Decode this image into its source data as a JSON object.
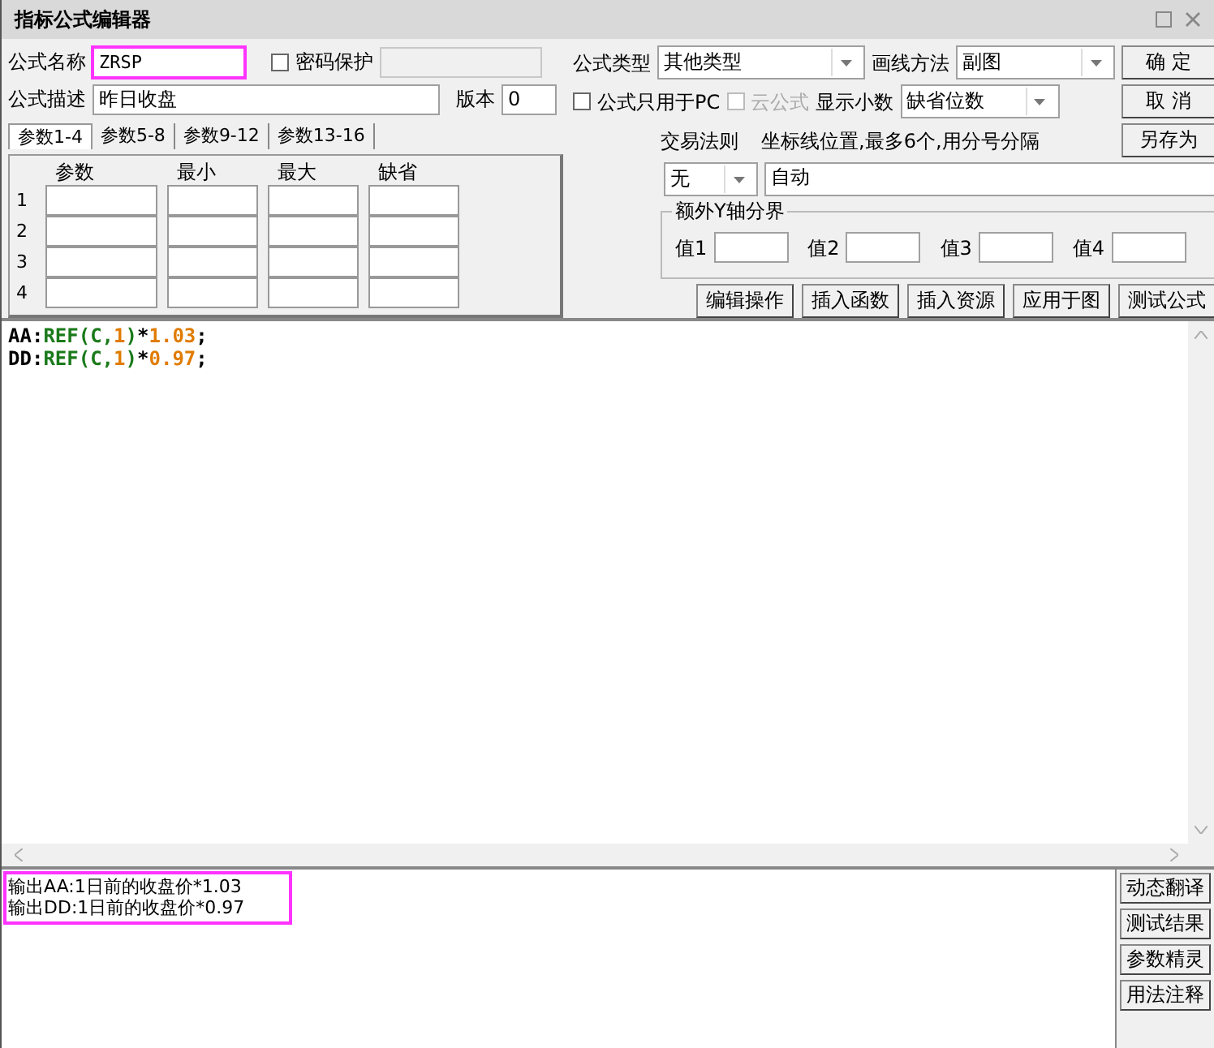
{
  "window": {
    "title": "指标公式编辑器"
  },
  "formula": {
    "name_label": "公式名称",
    "name_value": "ZRSP",
    "name_highlighted": true,
    "password": {
      "label": "密码保护",
      "checked": false
    },
    "desc_label": "公式描述",
    "desc_value": "昨日收盘",
    "version_label": "版本",
    "version_value": "0"
  },
  "param_tabs": [
    {
      "label": "参数1-4",
      "selected": true
    },
    {
      "label": "参数5-8",
      "selected": false
    },
    {
      "label": "参数9-12",
      "selected": false
    },
    {
      "label": "参数13-16",
      "selected": false
    }
  ],
  "param_table": {
    "columns": [
      "参数",
      "最小",
      "最大",
      "缺省"
    ],
    "rows": [
      "1",
      "2",
      "3",
      "4"
    ]
  },
  "settings": {
    "type": {
      "label": "公式类型",
      "value": "其他类型"
    },
    "draw_method": {
      "label": "画线方法",
      "value": "副图"
    },
    "pc_only": {
      "label": "公式只用于PC",
      "checked": false,
      "disabled": false
    },
    "cloud": {
      "label": "云公式",
      "checked": false,
      "disabled": true
    },
    "decimals": {
      "label": "显示小数",
      "value": "缺省位数"
    },
    "trade_rule": {
      "label": "交易法则",
      "value": "无"
    },
    "axis_lines": {
      "label": "坐标线位置,最多6个,用分号分隔",
      "value": "自动"
    },
    "y_bounds": {
      "title": "额外Y轴分界",
      "values": [
        {
          "label": "值1"
        },
        {
          "label": "值2"
        },
        {
          "label": "值3"
        },
        {
          "label": "值4"
        }
      ]
    }
  },
  "dialog_buttons": [
    "确 定",
    "取 消",
    "另存为"
  ],
  "action_buttons": [
    "编辑操作",
    "插入函数",
    "插入资源",
    "应用于图",
    "测试公式"
  ],
  "editor": {
    "lines": [
      [
        {
          "text": "AA:",
          "kind": "plain"
        },
        {
          "text": "REF(C,",
          "kind": "func"
        },
        {
          "text": "1",
          "kind": "num"
        },
        {
          "text": ")",
          "kind": "func"
        },
        {
          "text": "*",
          "kind": "plain"
        },
        {
          "text": "1.03",
          "kind": "num"
        },
        {
          "text": ";",
          "kind": "plain"
        }
      ],
      [
        {
          "text": "DD:",
          "kind": "plain"
        },
        {
          "text": "REF(C,",
          "kind": "func"
        },
        {
          "text": "1",
          "kind": "num"
        },
        {
          "text": ")",
          "kind": "func"
        },
        {
          "text": "*",
          "kind": "plain"
        },
        {
          "text": "0.97",
          "kind": "num"
        },
        {
          "text": ";",
          "kind": "plain"
        }
      ]
    ]
  },
  "output": {
    "highlighted": true,
    "lines": [
      "输出AA:1日前的收盘价*1.03",
      "输出DD:1日前的收盘价*0.97"
    ]
  },
  "side_buttons": [
    "动态翻译",
    "测试结果",
    "参数精灵",
    "用法注释"
  ]
}
